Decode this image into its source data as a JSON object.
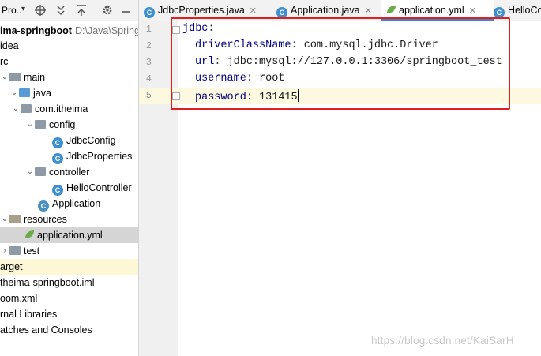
{
  "project_panel": {
    "title": "Pro..",
    "tree": [
      {
        "label": "ima-springboot",
        "path": "D:\\Java\\Spring"
      },
      {
        "label": "idea"
      },
      {
        "label": "rc"
      },
      {
        "label": "main"
      },
      {
        "label": "java"
      },
      {
        "label": "com.itheima"
      },
      {
        "label": "config"
      },
      {
        "label": "JdbcConfig"
      },
      {
        "label": "JdbcProperties"
      },
      {
        "label": "controller"
      },
      {
        "label": "HelloController"
      },
      {
        "label": "Application"
      },
      {
        "label": "resources"
      },
      {
        "label": "application.yml"
      },
      {
        "label": "test"
      },
      {
        "label": "arget"
      },
      {
        "label": "theima-springboot.iml"
      },
      {
        "label": "oom.xml"
      },
      {
        "label": "rnal Libraries"
      },
      {
        "label": "atches and Consoles"
      }
    ]
  },
  "tabs": [
    {
      "label": "JdbcProperties.java"
    },
    {
      "label": "Application.java"
    },
    {
      "label": "application.yml"
    },
    {
      "label": "HelloCo"
    }
  ],
  "editor": {
    "line_numbers": [
      "1",
      "2",
      "3",
      "4",
      "5"
    ],
    "lines": [
      {
        "key": "jdbc",
        "sep": ":",
        "value": ""
      },
      {
        "key": "driverClassName",
        "sep": ": ",
        "value": "com.mysql.jdbc.Driver"
      },
      {
        "key": "url",
        "sep": ": ",
        "value": "jdbc:mysql://127.0.0.1:3306/springboot_test"
      },
      {
        "key": "username",
        "sep": ": ",
        "value": "root"
      },
      {
        "key": "password",
        "sep": ": ",
        "value": "131415"
      }
    ]
  },
  "watermark": "https://blog.csdn.net/KaiSarH",
  "colors": {
    "highlight_box": "#e02020",
    "yaml_key": "#000080",
    "active_tab_underline": "#4083c9"
  }
}
